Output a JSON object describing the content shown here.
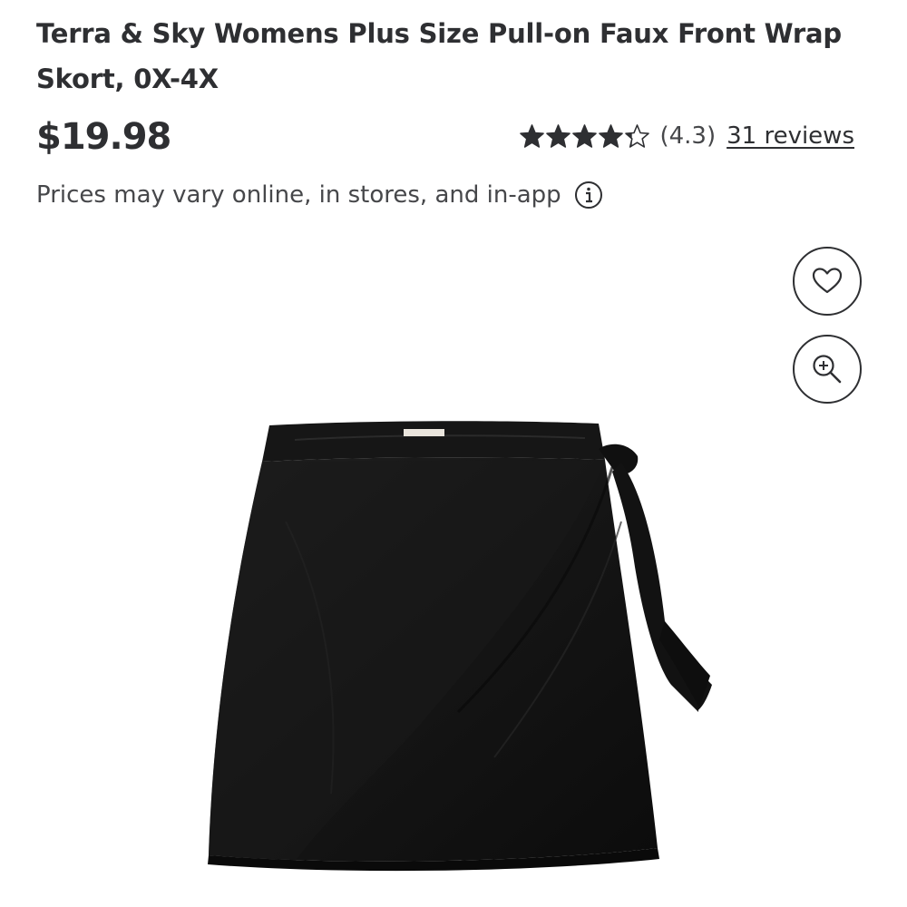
{
  "product": {
    "title": "Terra & Sky Womens Plus Size Pull-on Faux Front Wrap Skort, 0X-4X",
    "price": "$19.98",
    "price_note": "Prices may vary online, in stores, and in-app",
    "rating": {
      "stars": 4.3,
      "value_label": "(4.3)",
      "reviews_label": "31 reviews"
    }
  },
  "actions": {
    "favorite_icon": "heart-icon",
    "zoom_icon": "zoom-in-icon",
    "info_icon": "info-icon"
  },
  "image": {
    "subject": "black wrap skort",
    "color": "#141414"
  }
}
